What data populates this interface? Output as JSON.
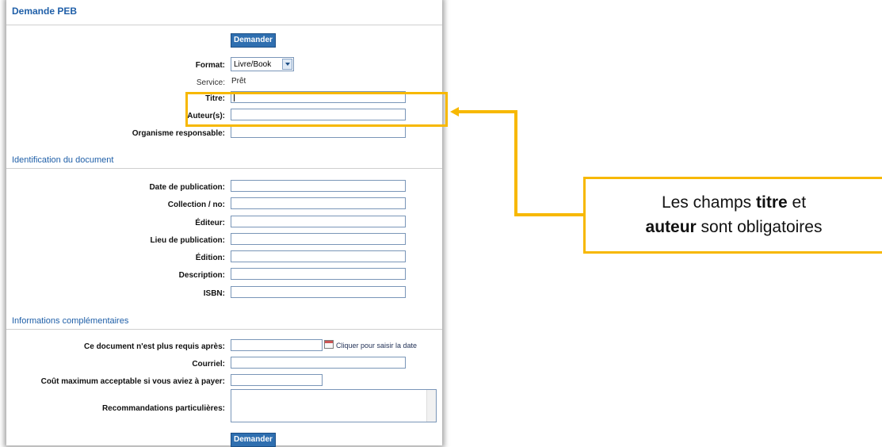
{
  "form": {
    "title": "Demande PEB",
    "submit_top": "Demander",
    "format_label": "Format:",
    "format_value": "Livre/Book",
    "service_label": "Service:",
    "service_value": "Prêt",
    "titre_label": "Titre:",
    "auteur_label": "Auteur(s):",
    "organisme_label": "Organisme responsable:",
    "section_identification": "Identification du document",
    "date_pub_label": "Date de publication:",
    "collection_label": "Collection / no:",
    "editeur_label": "Éditeur:",
    "lieu_label": "Lieu de publication:",
    "edition_label": "Édition:",
    "description_label": "Description:",
    "isbn_label": "ISBN:",
    "section_infos": "Informations complémentaires",
    "requis_label": "Ce document n'est plus requis après:",
    "calendar_link": "Cliquer pour saisir la date",
    "courriel_label": "Courriel:",
    "cout_label": "Coût maximum acceptable si vous aviez à payer:",
    "recommandations_label": "Recommandations particulières:",
    "submit_bottom": "Demander"
  },
  "callout": {
    "part1": "Les champs ",
    "bold1": "titre",
    "part2": " et",
    "bold2": "auteur",
    "part3": " sont obligatoires"
  },
  "colors": {
    "highlight": "#f7b800",
    "section_title": "#1f5fa8",
    "button": "#2f6fb0"
  }
}
